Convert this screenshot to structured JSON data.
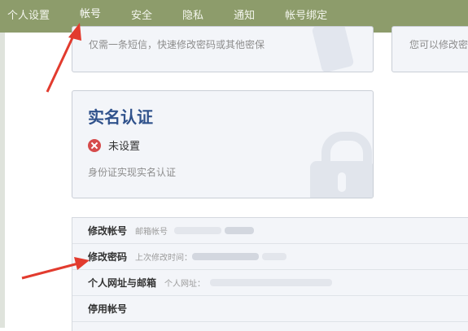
{
  "nav": {
    "items": [
      "个人设置",
      "帐号",
      "安全",
      "隐私",
      "通知",
      "帐号绑定"
    ],
    "active_index": 1
  },
  "cards": {
    "sms_desc": "仅需一条短信，快速修改密码或其他密保",
    "right_desc": "您可以修改密",
    "realname": {
      "title": "实名认证",
      "status": "未设置",
      "desc": "身份证实现实名认证"
    }
  },
  "list": [
    {
      "title": "修改帐号",
      "hint": "邮箱帐号"
    },
    {
      "title": "修改密码",
      "hint": "上次修改时间："
    },
    {
      "title": "个人网址与邮箱",
      "hint": "个人网址："
    },
    {
      "title": "停用帐号",
      "hint": ""
    }
  ],
  "colors": {
    "nav_bg": "#8d9c6b",
    "title_blue": "#30528c",
    "error_red": "#d64b4b",
    "arrow_red": "#e23b2e"
  }
}
